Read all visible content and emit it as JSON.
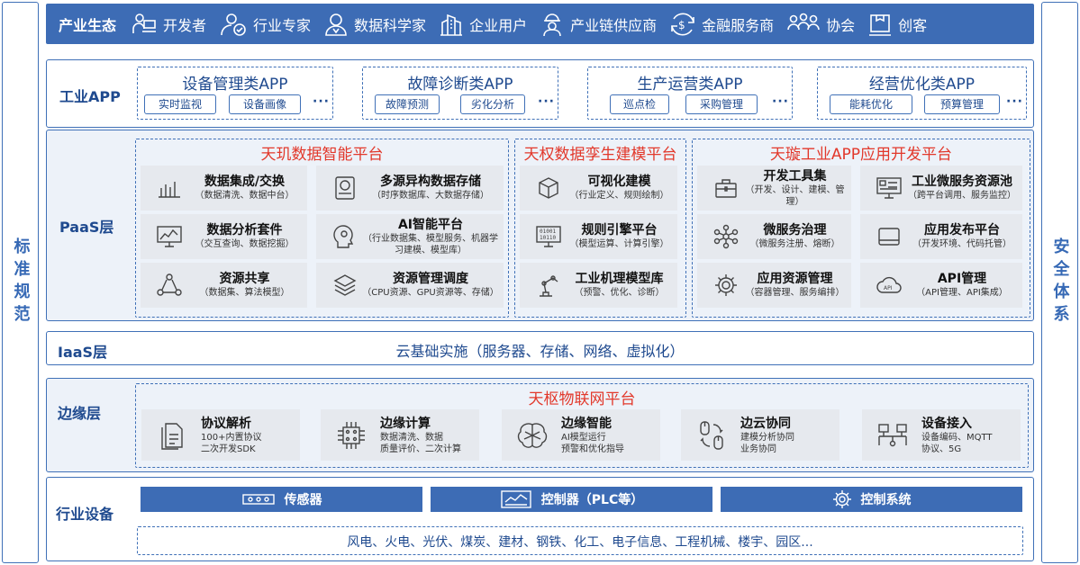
{
  "side_left": "标准规范",
  "side_right": "安全体系",
  "ecosystem": {
    "title": "产业生态",
    "items": [
      {
        "label": "开发者",
        "icon": "developer-icon"
      },
      {
        "label": "行业专家",
        "icon": "expert-icon"
      },
      {
        "label": "数据科学家",
        "icon": "scientist-icon"
      },
      {
        "label": "企业用户",
        "icon": "enterprise-icon"
      },
      {
        "label": "产业链供应商",
        "icon": "supplier-icon"
      },
      {
        "label": "金融服务商",
        "icon": "finance-icon"
      },
      {
        "label": "协会",
        "icon": "association-icon"
      },
      {
        "label": "创客",
        "icon": "maker-icon"
      }
    ]
  },
  "app_layer": {
    "title": "工业APP",
    "dots": "···",
    "groups": [
      {
        "title": "设备管理类APP",
        "tags": [
          "实时监视",
          "设备画像"
        ]
      },
      {
        "title": "故障诊断类APP",
        "tags": [
          "故障预测",
          "劣化分析"
        ]
      },
      {
        "title": "生产运营类APP",
        "tags": [
          "巡点检",
          "采购管理"
        ]
      },
      {
        "title": "经营优化类APP",
        "tags": [
          "能耗优化",
          "预算管理"
        ]
      }
    ]
  },
  "paas": {
    "title": "PaaS层",
    "platforms": [
      {
        "title": "天玑数据智能平台",
        "cards": [
          {
            "title": "数据集成/交换",
            "sub": "（数据清洗、数据中台）",
            "icon": "bar-chart-icon"
          },
          {
            "title": "多源异构数据存储",
            "sub": "（时序数据库、大数据存储）",
            "icon": "storage-icon"
          },
          {
            "title": "数据分析套件",
            "sub": "（交互查询、数据挖掘）",
            "icon": "analytics-icon"
          },
          {
            "title": "AI智能平台",
            "sub": "（行业数据集、模型服务、机器学习建模、模型库）",
            "icon": "ai-brain-icon"
          },
          {
            "title": "资源共享",
            "sub": "（数据集、算法模型）",
            "icon": "share-icon"
          },
          {
            "title": "资源管理调度",
            "sub": "（CPU资源、GPU资源等、存储）",
            "icon": "layers-icon"
          }
        ]
      },
      {
        "title": "天权数据孪生建模平台",
        "cards": [
          {
            "title": "可视化建模",
            "sub": "（行业定义、规则绘制）",
            "icon": "cube-icon"
          },
          {
            "title": "规则引擎平台",
            "sub": "（模型运算、计算引擎）",
            "icon": "binary-icon"
          },
          {
            "title": "工业机理模型库",
            "sub": "（预警、优化、诊断）",
            "icon": "robot-arm-icon"
          }
        ]
      },
      {
        "title": "天璇工业APP应用开发平台",
        "cards": [
          {
            "title": "开发工具集",
            "sub": "（开发、设计、建模、管理）",
            "icon": "toolbox-icon"
          },
          {
            "title": "工业微服务资源池",
            "sub": "（跨平台调用、服务监控）",
            "icon": "monitor-icon"
          },
          {
            "title": "微服务治理",
            "sub": "（微服务注册、熔断）",
            "icon": "network-icon"
          },
          {
            "title": "应用发布平台",
            "sub": "（开发环境、代码托管）",
            "icon": "window-icon"
          },
          {
            "title": "应用资源管理",
            "sub": "（容器管理、服务编排）",
            "icon": "gear-icon"
          },
          {
            "title": "API管理",
            "sub": "（API管理、API集成）",
            "icon": "api-cloud-icon"
          }
        ]
      }
    ]
  },
  "iaas": {
    "title": "IaaS层",
    "content": "云基础实施（服务器、存储、网络、虚拟化）"
  },
  "edge": {
    "title": "边缘层",
    "platform": "天枢物联网平台",
    "cards": [
      {
        "title": "协议解析",
        "sub": [
          "100+内置协议",
          "二次开发SDK"
        ],
        "icon": "document-icon"
      },
      {
        "title": "边缘计算",
        "sub": [
          "数据清洗、数据",
          "质量评价、二次计算"
        ],
        "icon": "chip-icon"
      },
      {
        "title": "边缘智能",
        "sub": [
          "AI模型运行",
          "预警和优化指导"
        ],
        "icon": "brain-icon"
      },
      {
        "title": "边云协同",
        "sub": [
          "建模分析协同",
          "业务协同"
        ],
        "icon": "sync-icon"
      },
      {
        "title": "设备接入",
        "sub": [
          "设备编码、MQTT",
          "协议、5G"
        ],
        "icon": "device-network-icon"
      }
    ]
  },
  "devices": {
    "title": "行业设备",
    "items": [
      {
        "label": "传感器",
        "icon": "sensor-icon"
      },
      {
        "label": "控制器（PLC等）",
        "icon": "controller-icon"
      },
      {
        "label": "控制系统",
        "icon": "control-gear-icon"
      }
    ],
    "industries": "风电、火电、光伏、煤炭、建材、钢铁、化工、电子信息、工程机械、楼宇、园区..."
  }
}
